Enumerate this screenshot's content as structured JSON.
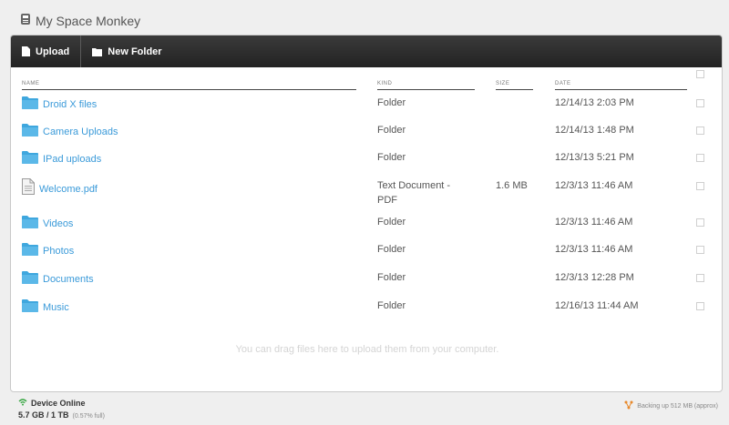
{
  "app": {
    "title": "My Space Monkey"
  },
  "toolbar": {
    "upload_label": "Upload",
    "new_folder_label": "New Folder"
  },
  "columns": {
    "name": "NAME",
    "kind": "KIND",
    "size": "SIZE",
    "date": "DATE"
  },
  "files": [
    {
      "name": "Droid X files",
      "kind": "Folder",
      "kind2": "",
      "size": "",
      "date": "12/14/13 2:03 PM",
      "icon": "folder-icon"
    },
    {
      "name": "Camera Uploads",
      "kind": "Folder",
      "kind2": "",
      "size": "",
      "date": "12/14/13 1:48 PM",
      "icon": "folder-icon"
    },
    {
      "name": "IPad uploads",
      "kind": "Folder",
      "kind2": "",
      "size": "",
      "date": "12/13/13 5:21 PM",
      "icon": "folder-icon"
    },
    {
      "name": "Welcome.pdf",
      "kind": "Text Document -",
      "kind2": "PDF",
      "size": "1.6 MB",
      "date": "12/3/13 11:46 AM",
      "icon": "document-icon"
    },
    {
      "name": "Videos",
      "kind": "Folder",
      "kind2": "",
      "size": "",
      "date": "12/3/13 11:46 AM",
      "icon": "folder-icon"
    },
    {
      "name": "Photos",
      "kind": "Folder",
      "kind2": "",
      "size": "",
      "date": "12/3/13 11:46 AM",
      "icon": "folder-icon"
    },
    {
      "name": "Documents",
      "kind": "Folder",
      "kind2": "",
      "size": "",
      "date": "12/3/13 12:28 PM",
      "icon": "folder-icon"
    },
    {
      "name": "Music",
      "kind": "Folder",
      "kind2": "",
      "size": "",
      "date": "12/16/13 11:44 AM",
      "icon": "folder-icon"
    }
  ],
  "drop_hint": "You can drag files here to upload them from your computer.",
  "footer": {
    "status": "Device Online",
    "usage": "5.7 GB / 1 TB",
    "usage_pct": "(0.57% full)",
    "backup": "Backing up 512 MB (approx)"
  },
  "colors": {
    "accent": "#3a9ad9",
    "toolbar": "#2b2b2b",
    "folder": "#3fa7de",
    "online": "#3aa845",
    "backup": "#e8892b"
  }
}
